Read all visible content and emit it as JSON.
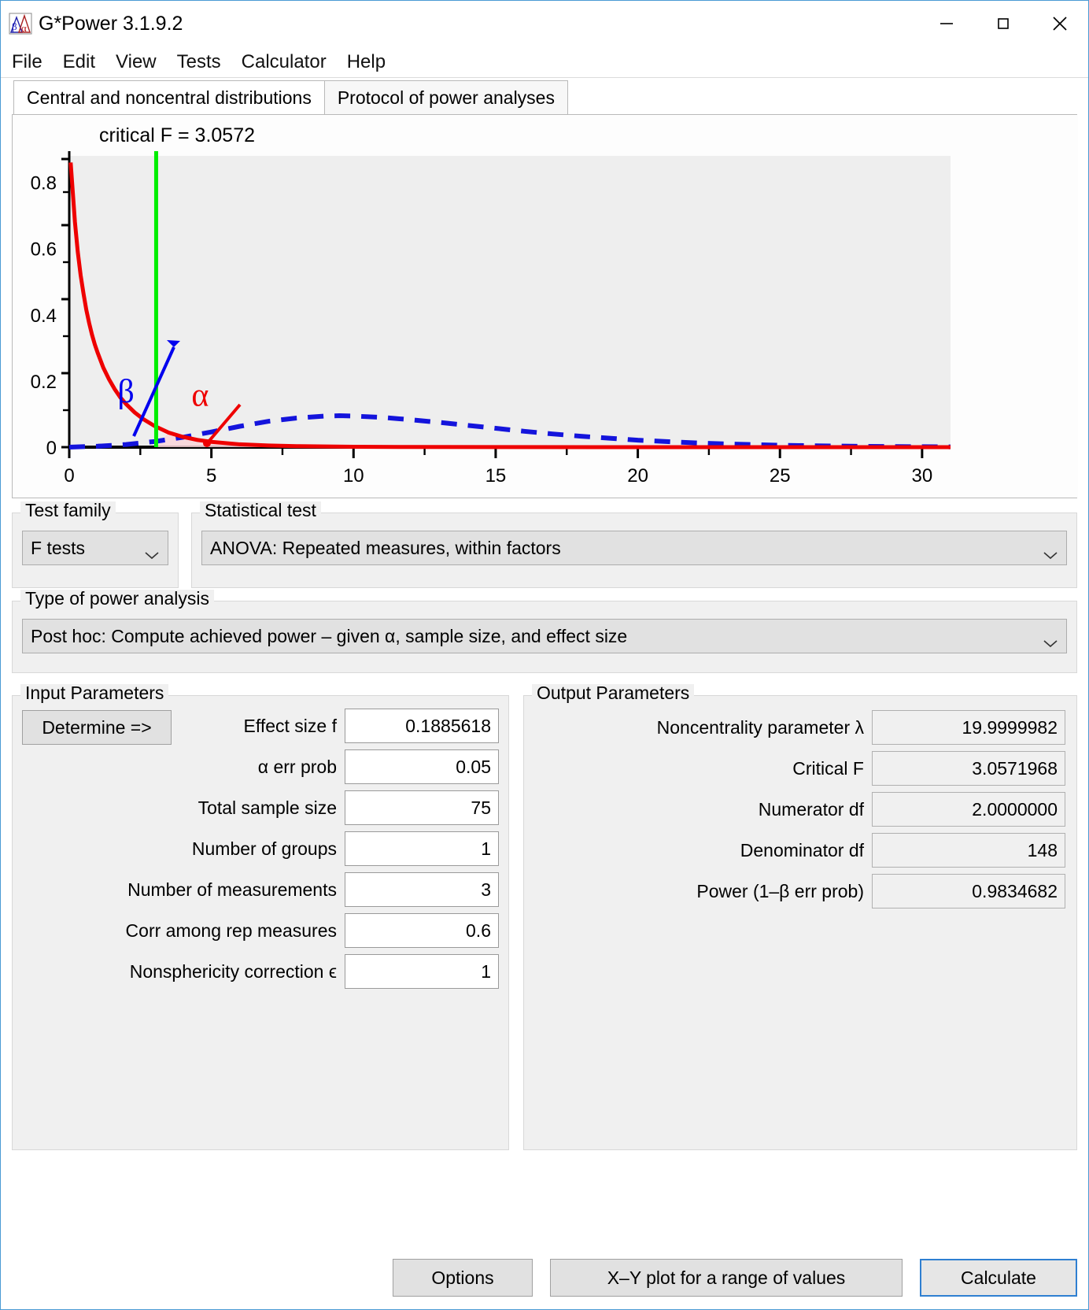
{
  "window": {
    "title": "G*Power 3.1.9.2",
    "icon": "gpower-icon",
    "minimize": "minimize-button",
    "maximize": "maximize-button",
    "close": "close-button"
  },
  "menu": {
    "items": [
      {
        "label": "File"
      },
      {
        "label": "Edit"
      },
      {
        "label": "View"
      },
      {
        "label": "Tests"
      },
      {
        "label": "Calculator"
      },
      {
        "label": "Help"
      }
    ]
  },
  "tabs": [
    {
      "label": "Central and noncentral distributions",
      "active": true
    },
    {
      "label": "Protocol of power analyses",
      "active": false
    }
  ],
  "chart_data": {
    "type": "line",
    "title": "critical F = 3.0572",
    "xlabel": "",
    "ylabel": "",
    "xlim": [
      0,
      31
    ],
    "ylim": [
      0,
      0.88
    ],
    "xticks": [
      0,
      5,
      10,
      15,
      20,
      25,
      30
    ],
    "yticks": [
      0,
      0.2,
      0.4,
      0.6,
      0.8
    ],
    "grid": false,
    "critical_value": 3.0572,
    "critical_line_color": "#00ee00",
    "annotations": [
      {
        "text": "β",
        "color": "#0000ee",
        "x": 1.7,
        "y": 0.135
      },
      {
        "text": "α",
        "color": "#ee0000",
        "x": 4.3,
        "y": 0.125
      }
    ],
    "series": [
      {
        "name": "central F distribution",
        "style": "solid",
        "color": "#ee0000",
        "x": [
          0.05,
          0.1,
          0.2,
          0.3,
          0.4,
          0.5,
          0.6,
          0.7,
          0.8,
          0.9,
          1.0,
          1.2,
          1.4,
          1.6,
          1.8,
          2.0,
          2.3,
          2.6,
          3.0,
          3.5,
          4.0,
          4.5,
          5.0,
          6.0,
          7.0,
          8.0,
          10.0,
          12.0,
          15.0,
          20.0,
          25.0,
          31.0
        ],
        "y": [
          0.86,
          0.8,
          0.68,
          0.59,
          0.52,
          0.465,
          0.415,
          0.375,
          0.34,
          0.31,
          0.285,
          0.24,
          0.205,
          0.175,
          0.15,
          0.13,
          0.105,
          0.085,
          0.064,
          0.044,
          0.031,
          0.022,
          0.016,
          0.0085,
          0.005,
          0.003,
          0.0012,
          0.0005,
          0.0002,
          5e-05,
          2e-05,
          1e-05
        ]
      },
      {
        "name": "noncentral F distribution",
        "style": "dashed",
        "color": "#1414dc",
        "x": [
          0,
          1,
          2,
          3,
          4,
          5,
          6,
          7,
          8,
          9,
          9.5,
          10,
          11,
          12,
          13,
          14,
          15,
          16,
          17,
          18,
          19,
          20,
          21,
          22,
          23,
          24,
          25,
          26,
          27,
          28,
          29,
          30,
          31
        ],
        "y": [
          0.0,
          0.003,
          0.008,
          0.017,
          0.03,
          0.046,
          0.063,
          0.078,
          0.088,
          0.094,
          0.095,
          0.094,
          0.09,
          0.083,
          0.075,
          0.066,
          0.057,
          0.048,
          0.04,
          0.033,
          0.027,
          0.021,
          0.017,
          0.013,
          0.01,
          0.0078,
          0.0059,
          0.0045,
          0.0034,
          0.0025,
          0.0019,
          0.0014,
          0.001
        ]
      }
    ]
  },
  "test_family": {
    "label": "Test family",
    "value": "F tests"
  },
  "statistical_test": {
    "label": "Statistical test",
    "value": "ANOVA: Repeated measures, within factors"
  },
  "power_analysis": {
    "label": "Type of power analysis",
    "value": "Post hoc: Compute achieved power – given α, sample size, and effect size"
  },
  "input_parameters": {
    "label": "Input Parameters",
    "determine_button": "Determine =>",
    "rows": [
      {
        "label": "Effect size f",
        "value": "0.1885618"
      },
      {
        "label": "α err prob",
        "value": "0.05"
      },
      {
        "label": "Total sample size",
        "value": "75"
      },
      {
        "label": "Number of groups",
        "value": "1"
      },
      {
        "label": "Number of measurements",
        "value": "3"
      },
      {
        "label": "Corr among rep measures",
        "value": "0.6"
      },
      {
        "label": "Nonsphericity correction ϵ",
        "value": "1"
      }
    ]
  },
  "output_parameters": {
    "label": "Output Parameters",
    "rows": [
      {
        "label": "Noncentrality parameter λ",
        "value": "19.9999982"
      },
      {
        "label": "Critical F",
        "value": "3.0571968"
      },
      {
        "label": "Numerator df",
        "value": "2.0000000"
      },
      {
        "label": "Denominator df",
        "value": "148"
      },
      {
        "label": "Power (1–β err prob)",
        "value": "0.9834682"
      }
    ]
  },
  "footer": {
    "options": "Options",
    "xy_plot": "X–Y plot for a range of values",
    "calculate": "Calculate"
  }
}
